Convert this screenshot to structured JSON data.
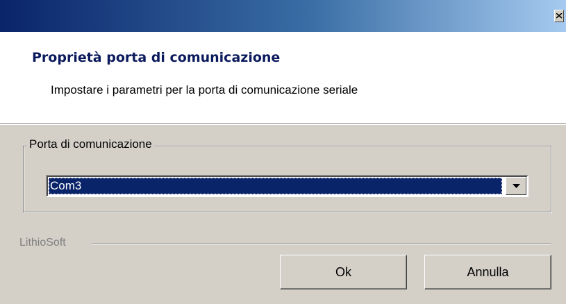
{
  "window": {
    "close_icon": "close-x-icon"
  },
  "header": {
    "title": "Proprietà porta di comunicazione",
    "subtitle": "Impostare i parametri per la porta di comunicazione seriale"
  },
  "port_group": {
    "label": "Porta di comunicazione",
    "selected_value": "Com3",
    "dropdown_icon": "chevron-down-icon"
  },
  "footer": {
    "brand": "LithioSoft",
    "ok_label": "Ok",
    "cancel_label": "Annulla"
  },
  "colors": {
    "titlebar_start": "#0a246a",
    "titlebar_end": "#a6caf0",
    "dialog_face": "#d4d0c8",
    "selection": "#0a246a"
  }
}
